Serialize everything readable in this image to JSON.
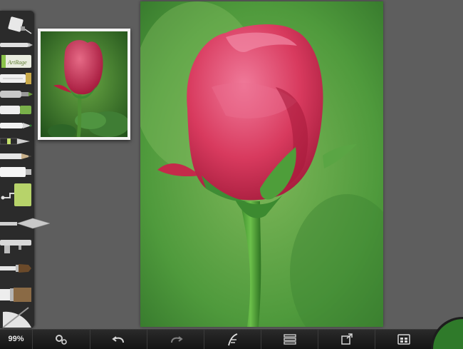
{
  "toolbar": {
    "tools": [
      {
        "name": "glue-tube-icon"
      },
      {
        "name": "pencil-thin-icon"
      },
      {
        "name": "artrage-crayon-icon",
        "label": "ArtRage"
      },
      {
        "name": "palette-knife-tube-icon"
      },
      {
        "name": "airbrush-icon"
      },
      {
        "name": "marker-icon"
      },
      {
        "name": "felt-pen-icon"
      },
      {
        "name": "ink-pen-icon"
      },
      {
        "name": "pencil-icon"
      },
      {
        "name": "paint-tube-icon"
      },
      {
        "name": "paint-roller-icon"
      },
      {
        "name": "palette-knife-icon"
      },
      {
        "name": "spray-gun-icon"
      },
      {
        "name": "flat-brush-icon"
      },
      {
        "name": "wide-brush-icon"
      },
      {
        "name": "eraser-fan-icon"
      }
    ]
  },
  "bottombar": {
    "zoom": "99%",
    "buttons": [
      {
        "name": "settings-gear-icon"
      },
      {
        "name": "undo-arrow-icon"
      },
      {
        "name": "redo-arrow-icon"
      },
      {
        "name": "tool-settings-icon"
      },
      {
        "name": "layers-icon"
      },
      {
        "name": "share-export-icon"
      },
      {
        "name": "gallery-menu-icon"
      }
    ]
  },
  "colors": {
    "canvas_bg": "#5e5e5e",
    "toolbar_bg": "#2b2b2b",
    "current_color": "#2f7a2a",
    "rose": "#d83a5e",
    "leaf": "#3f8c35"
  }
}
